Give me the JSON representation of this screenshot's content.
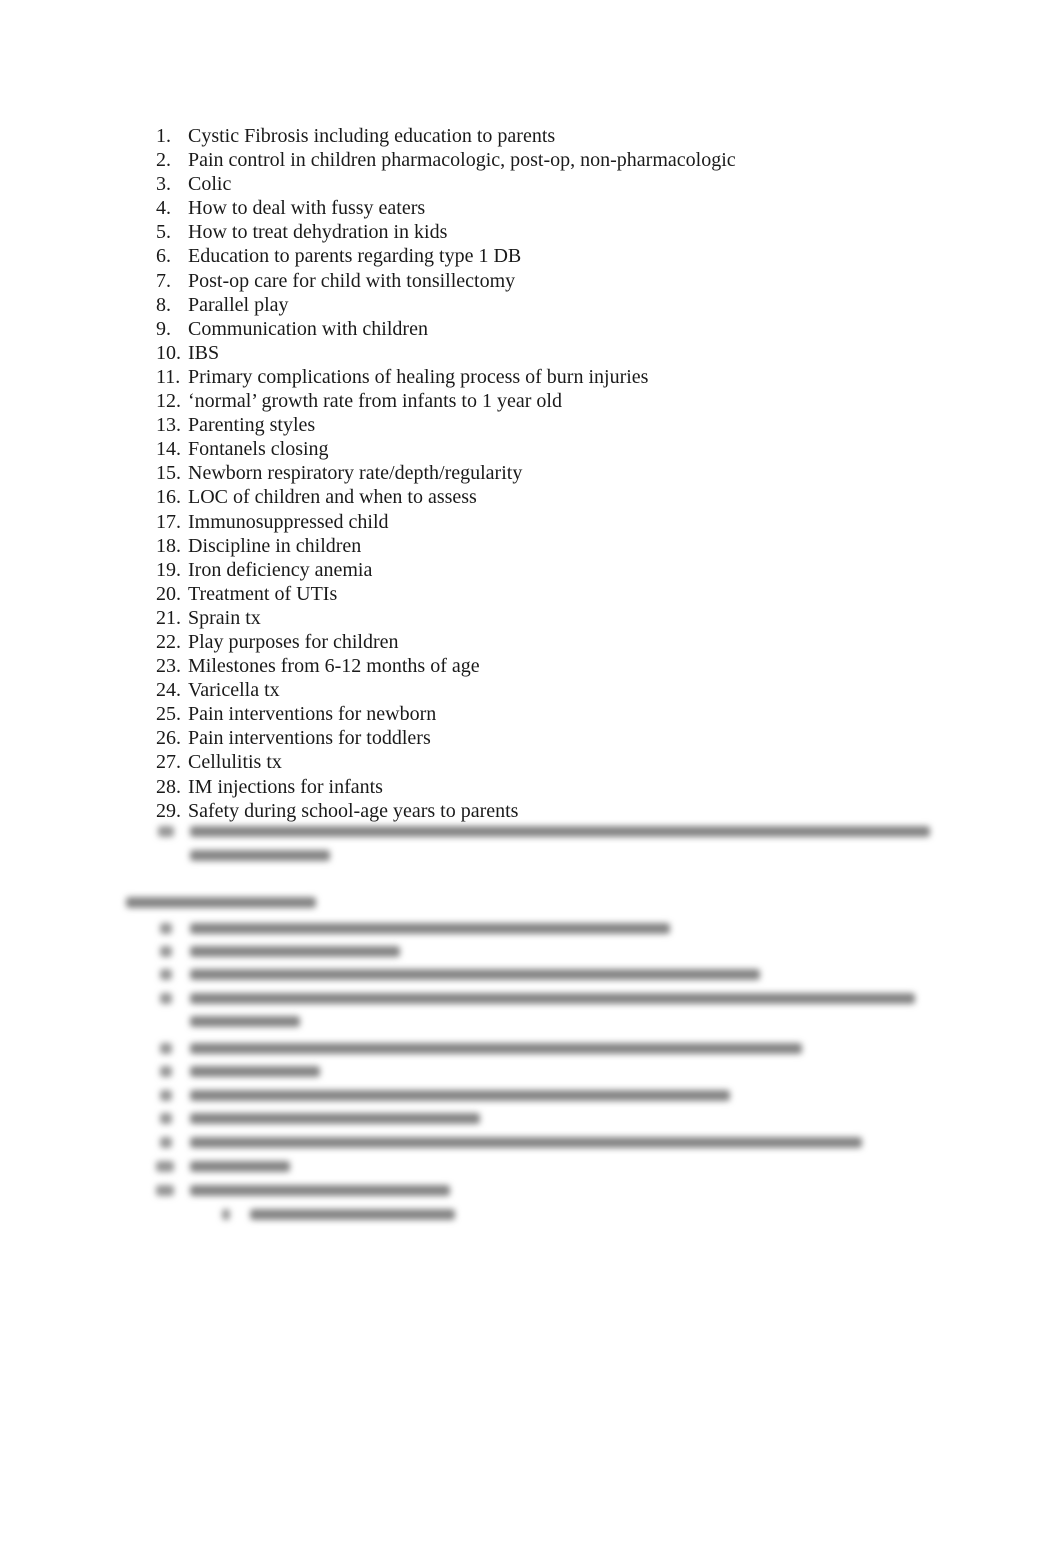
{
  "document": {
    "visible_list": [
      {
        "number": "1.",
        "text": "Cystic Fibrosis including education to parents"
      },
      {
        "number": "2.",
        "text": "Pain control in children pharmacologic, post-op, non-pharmacologic"
      },
      {
        "number": "3.",
        "text": "Colic"
      },
      {
        "number": "4.",
        "text": "How to deal with fussy eaters"
      },
      {
        "number": "5.",
        "text": "How to treat dehydration in kids"
      },
      {
        "number": "6.",
        "text": "Education to parents regarding type 1 DB"
      },
      {
        "number": "7.",
        "text": "Post-op care for child with tonsillectomy"
      },
      {
        "number": "8.",
        "text": "Parallel play"
      },
      {
        "number": "9.",
        "text": "Communication with children"
      },
      {
        "number": "10.",
        "text": "IBS"
      },
      {
        "number": "11.",
        "text": "Primary complications of healing process of burn injuries"
      },
      {
        "number": "12.",
        "text": "‘normal’ growth rate from infants to 1 year old"
      },
      {
        "number": "13.",
        "text": "Parenting styles"
      },
      {
        "number": "14.",
        "text": "Fontanels closing"
      },
      {
        "number": "15.",
        "text": "Newborn respiratory rate/depth/regularity"
      },
      {
        "number": "16.",
        "text": "LOC of children and when to assess"
      },
      {
        "number": "17.",
        "text": "Immunosuppressed child"
      },
      {
        "number": "18.",
        "text": "Discipline in children"
      },
      {
        "number": "19.",
        "text": "Iron deficiency anemia"
      },
      {
        "number": "20.",
        "text": "Treatment of UTIs"
      },
      {
        "number": "21.",
        "text": "Sprain tx"
      },
      {
        "number": "22.",
        "text": "Play purposes for children"
      },
      {
        "number": "23.",
        "text": "Milestones from 6-12 months of age"
      },
      {
        "number": "24.",
        "text": "Varicella tx"
      },
      {
        "number": "25.",
        "text": "Pain interventions for newborn"
      },
      {
        "number": "26.",
        "text": "Pain interventions for toddlers"
      },
      {
        "number": "27.",
        "text": "Cellulitis tx"
      },
      {
        "number": "28.",
        "text": "IM injections for infants"
      },
      {
        "number": "29.",
        "text": "Safety during school-age years to parents"
      }
    ],
    "blurred_section": {
      "readable": false,
      "note": "content obscured (blurred preview)"
    }
  }
}
